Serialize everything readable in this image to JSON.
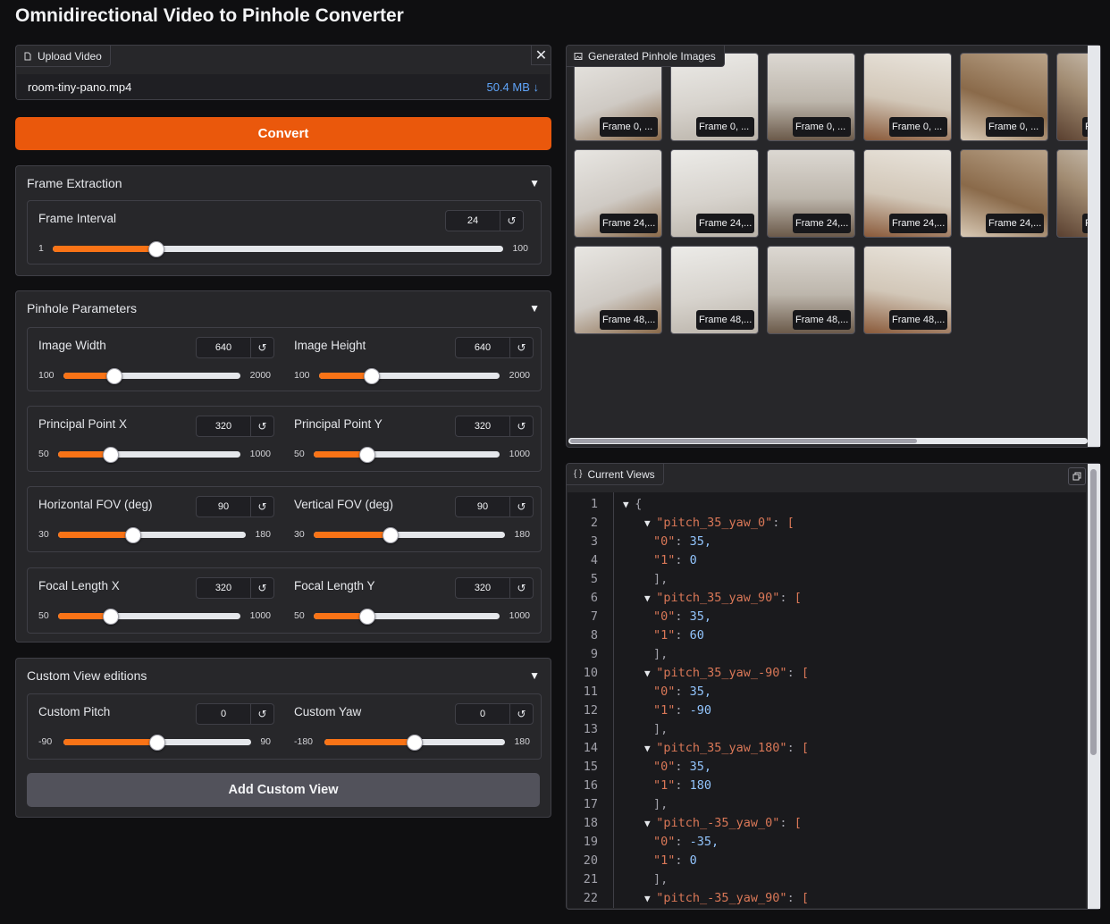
{
  "app": {
    "title": "Omnidirectional Video to Pinhole Converter"
  },
  "upload": {
    "label": "Upload Video",
    "file_name": "room-tiny-pano.mp4",
    "file_size": "50.4 MB ↓",
    "close_icon": "close-icon"
  },
  "convert_button": "Convert",
  "frame_extraction": {
    "title": "Frame Extraction",
    "frame_interval": {
      "label": "Frame Interval",
      "value": "24",
      "min": "1",
      "max": "100",
      "fraction": 0.23
    }
  },
  "pinhole": {
    "title": "Pinhole Parameters",
    "image_width": {
      "label": "Image Width",
      "value": "640",
      "min": "100",
      "max": "2000",
      "fraction": 0.29
    },
    "image_height": {
      "label": "Image Height",
      "value": "640",
      "min": "100",
      "max": "2000",
      "fraction": 0.29
    },
    "ppx": {
      "label": "Principal Point X",
      "value": "320",
      "min": "50",
      "max": "1000",
      "fraction": 0.29
    },
    "ppy": {
      "label": "Principal Point Y",
      "value": "320",
      "min": "50",
      "max": "1000",
      "fraction": 0.29
    },
    "hfov": {
      "label": "Horizontal FOV (deg)",
      "value": "90",
      "min": "30",
      "max": "180",
      "fraction": 0.4
    },
    "vfov": {
      "label": "Vertical FOV (deg)",
      "value": "90",
      "min": "30",
      "max": "180",
      "fraction": 0.4
    },
    "fx": {
      "label": "Focal Length X",
      "value": "320",
      "min": "50",
      "max": "1000",
      "fraction": 0.29
    },
    "fy": {
      "label": "Focal Length Y",
      "value": "320",
      "min": "50",
      "max": "1000",
      "fraction": 0.29
    }
  },
  "custom": {
    "title": "Custom View editions",
    "pitch": {
      "label": "Custom Pitch",
      "value": "0",
      "min": "-90",
      "max": "90",
      "fraction": 0.5
    },
    "yaw": {
      "label": "Custom Yaw",
      "value": "0",
      "min": "-180",
      "max": "180",
      "fraction": 0.5
    },
    "add_button": "Add Custom View"
  },
  "gallery": {
    "label": "Generated Pinhole Images",
    "rows": [
      [
        "Frame 0, ...",
        "Frame 0, ...",
        "Frame 0, ...",
        "Frame 0, ...",
        "Frame 0, ...",
        "F"
      ],
      [
        "Frame 24,...",
        "Frame 24,...",
        "Frame 24,...",
        "Frame 24,...",
        "Frame 24,...",
        "F"
      ],
      [
        "Frame 48,...",
        "Frame 48,...",
        "Frame 48,...",
        "Frame 48,..."
      ]
    ]
  },
  "current_views": {
    "label": "Current Views",
    "lines": [
      "{",
      "\"pitch_35_yaw_0\": [",
      "\"0\": 35,",
      "\"1\": 0",
      "],",
      "\"pitch_35_yaw_90\": [",
      "\"0\": 35,",
      "\"1\": 60",
      "],",
      "\"pitch_35_yaw_-90\": [",
      "\"0\": 35,",
      "\"1\": -90",
      "],",
      "\"pitch_35_yaw_180\": [",
      "\"0\": 35,",
      "\"1\": 180",
      "],",
      "\"pitch_-35_yaw_0\": [",
      "\"0\": -35,",
      "\"1\": 0",
      "],",
      "\"pitch_-35_yaw_90\": ["
    ]
  }
}
